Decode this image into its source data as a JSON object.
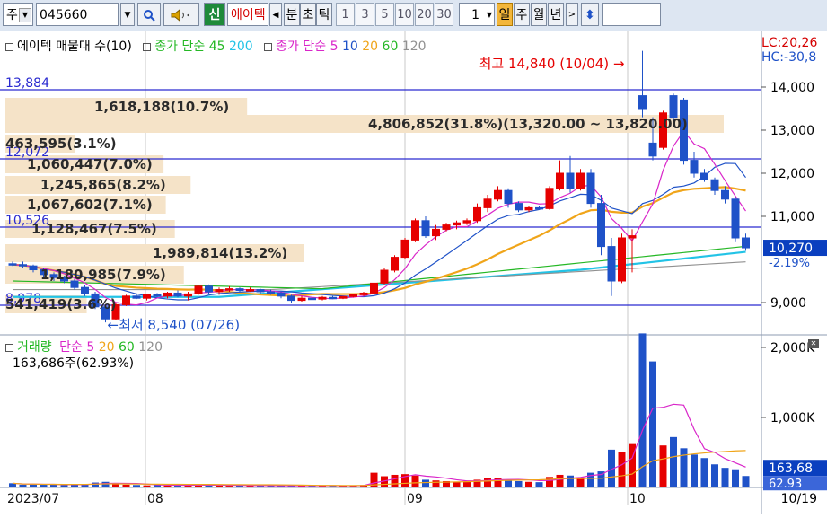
{
  "toolbar": {
    "market": "주",
    "code": "045660",
    "new_label": "신",
    "name": "에이텍",
    "period_buttons": [
      "분",
      "초",
      "틱"
    ],
    "interval_numbers": [
      "1",
      "3",
      "5",
      "10",
      "20",
      "30"
    ],
    "current_interval": "1",
    "range_buttons": [
      "일",
      "주",
      "월",
      "년"
    ],
    "active_range": "일"
  },
  "colors": {
    "up": "#e60000",
    "down": "#1f52c8",
    "ma5": "#d926c9",
    "ma10": "#1f52c8",
    "ma20": "#f0a51a",
    "ma60": "#25b825",
    "ma120": "#909090",
    "ma200": "#22c3e6",
    "highlight_bar": "#f5e3c8",
    "axis_highlight": "#0a3fbf"
  },
  "price_panel": {
    "legend": {
      "title": "에이텍 매물대 수(10)",
      "ma_group1_label": "종가 단순",
      "ma_group1_values": [
        "45",
        "200"
      ],
      "ma_group2_label": "종가 단순",
      "ma_group2_values": [
        "5",
        "10",
        "20",
        "60",
        "120"
      ]
    },
    "top_right": [
      "LC:20,26",
      "HC:-30,8"
    ],
    "high_annotation": "최고 14,840 (10/04)",
    "low_annotation": "최저 8,540 (07/26)",
    "reference_levels": [
      "13,884",
      "12,072",
      "10,526",
      "8,978"
    ],
    "volume_profile": [
      "1,618,188(10.7%)",
      "4,806,852(31.8%)(13,320.00 ~ 13,820.00)",
      "463,595(3.1%)",
      "1,060,447(7.0%)",
      "1,245,865(8.2%)",
      "1,067,602(7.1%)",
      "1,128,467(7.5%)",
      "1,989,814(13.2%)",
      "1,180,985(7.9%)",
      "541,419(3.6%)"
    ],
    "y_ticks": [
      "14,000",
      "13,000",
      "12,000",
      "11,000",
      "9,000"
    ],
    "current_price": "10,270",
    "current_change": "-2.19%"
  },
  "volume_panel": {
    "legend_title": "거래량",
    "ma_label": "단순",
    "ma_values": [
      "5",
      "20",
      "60",
      "120"
    ],
    "current_volume": "163,686주(62.93%)",
    "y_ticks": [
      "2,000K",
      "1,000K"
    ],
    "current_value": "163,68",
    "current_ratio": "62.93"
  },
  "x_axis": {
    "labels": [
      "2023/07",
      "08",
      "09",
      "10"
    ],
    "last_date": "10/19"
  },
  "chart_data": {
    "type": "candlestick",
    "columns": [
      "open",
      "high",
      "low",
      "close"
    ],
    "candles": [
      [
        9900,
        9950,
        9850,
        9880
      ],
      [
        9880,
        9950,
        9800,
        9850
      ],
      [
        9850,
        9880,
        9700,
        9760
      ],
      [
        9760,
        9800,
        9600,
        9650
      ],
      [
        9650,
        9700,
        9500,
        9580
      ],
      [
        9580,
        9620,
        9450,
        9500
      ],
      [
        9500,
        9550,
        9300,
        9350
      ],
      [
        9350,
        9400,
        9150,
        9200
      ],
      [
        9200,
        9250,
        8850,
        8900
      ],
      [
        8900,
        8950,
        8540,
        8620
      ],
      [
        8620,
        9000,
        8600,
        8950
      ],
      [
        8950,
        9180,
        8920,
        9150
      ],
      [
        9150,
        9200,
        9080,
        9100
      ],
      [
        9100,
        9200,
        9050,
        9180
      ],
      [
        9180,
        9220,
        9120,
        9150
      ],
      [
        9150,
        9250,
        9100,
        9220
      ],
      [
        9220,
        9280,
        9120,
        9150
      ],
      [
        9150,
        9250,
        9050,
        9200
      ],
      [
        9200,
        9400,
        9180,
        9380
      ],
      [
        9380,
        9420,
        9200,
        9250
      ],
      [
        9250,
        9350,
        9180,
        9300
      ],
      [
        9300,
        9380,
        9250,
        9320
      ],
      [
        9320,
        9350,
        9250,
        9280
      ],
      [
        9280,
        9350,
        9250,
        9300
      ],
      [
        9300,
        9320,
        9200,
        9250
      ],
      [
        9250,
        9300,
        9180,
        9220
      ],
      [
        9220,
        9250,
        9100,
        9150
      ],
      [
        9150,
        9180,
        9000,
        9050
      ],
      [
        9050,
        9150,
        9020,
        9100
      ],
      [
        9100,
        9150,
        9050,
        9080
      ],
      [
        9080,
        9150,
        9050,
        9120
      ],
      [
        9120,
        9150,
        9080,
        9100
      ],
      [
        9100,
        9150,
        9080,
        9140
      ],
      [
        9140,
        9200,
        9120,
        9180
      ],
      [
        9180,
        9250,
        9150,
        9220
      ],
      [
        9220,
        9500,
        9200,
        9450
      ],
      [
        9450,
        9800,
        9420,
        9750
      ],
      [
        9750,
        10100,
        9700,
        10050
      ],
      [
        10050,
        10500,
        10000,
        10450
      ],
      [
        10450,
        10950,
        10400,
        10900
      ],
      [
        10900,
        11000,
        10500,
        10550
      ],
      [
        10550,
        10800,
        10450,
        10700
      ],
      [
        10700,
        10850,
        10650,
        10800
      ],
      [
        10800,
        10900,
        10700,
        10850
      ],
      [
        10850,
        10950,
        10800,
        10900
      ],
      [
        10900,
        11300,
        10850,
        11200
      ],
      [
        11200,
        11500,
        11100,
        11400
      ],
      [
        11400,
        11700,
        11350,
        11600
      ],
      [
        11600,
        11650,
        11200,
        11300
      ],
      [
        11300,
        11350,
        11100,
        11150
      ],
      [
        11150,
        11250,
        11100,
        11200
      ],
      [
        11200,
        11250,
        11150,
        11180
      ],
      [
        11180,
        11700,
        11150,
        11650
      ],
      [
        11650,
        12300,
        11600,
        12000
      ],
      [
        12000,
        12400,
        11550,
        11650
      ],
      [
        11650,
        12100,
        11600,
        12000
      ],
      [
        12000,
        12100,
        11200,
        11300
      ],
      [
        11300,
        11500,
        10100,
        10300
      ],
      [
        10300,
        10500,
        9150,
        9500
      ],
      [
        9500,
        10600,
        9450,
        10500
      ],
      [
        10500,
        10700,
        9700,
        10550
      ],
      [
        13800,
        14840,
        13300,
        13500
      ],
      [
        12700,
        13300,
        12300,
        12400
      ],
      [
        12600,
        13450,
        12550,
        13400
      ],
      [
        13800,
        13850,
        13200,
        13300
      ],
      [
        13700,
        13750,
        12200,
        12300
      ],
      [
        12300,
        12500,
        11900,
        12000
      ],
      [
        12000,
        12100,
        11800,
        11850
      ],
      [
        11850,
        11900,
        11500,
        11600
      ],
      [
        11600,
        11700,
        11300,
        11400
      ],
      [
        11400,
        11450,
        10400,
        10500
      ],
      [
        10500,
        10600,
        10200,
        10270
      ]
    ],
    "volume_k": [
      60,
      40,
      45,
      38,
      42,
      35,
      50,
      45,
      70,
      80,
      55,
      40,
      35,
      30,
      32,
      28,
      30,
      35,
      40,
      30,
      28,
      25,
      30,
      27,
      26,
      24,
      22,
      30,
      28,
      25,
      24,
      22,
      26,
      28,
      35,
      210,
      160,
      180,
      190,
      170,
      110,
      100,
      90,
      80,
      85,
      110,
      130,
      140,
      100,
      90,
      80,
      75,
      150,
      180,
      170,
      140,
      210,
      230,
      540,
      500,
      620,
      2200,
      1800,
      600,
      720,
      560,
      470,
      420,
      330,
      280,
      260,
      163.686
    ],
    "price_ylim": [
      8500,
      14900
    ],
    "volume_ylim": [
      0,
      2400
    ]
  }
}
